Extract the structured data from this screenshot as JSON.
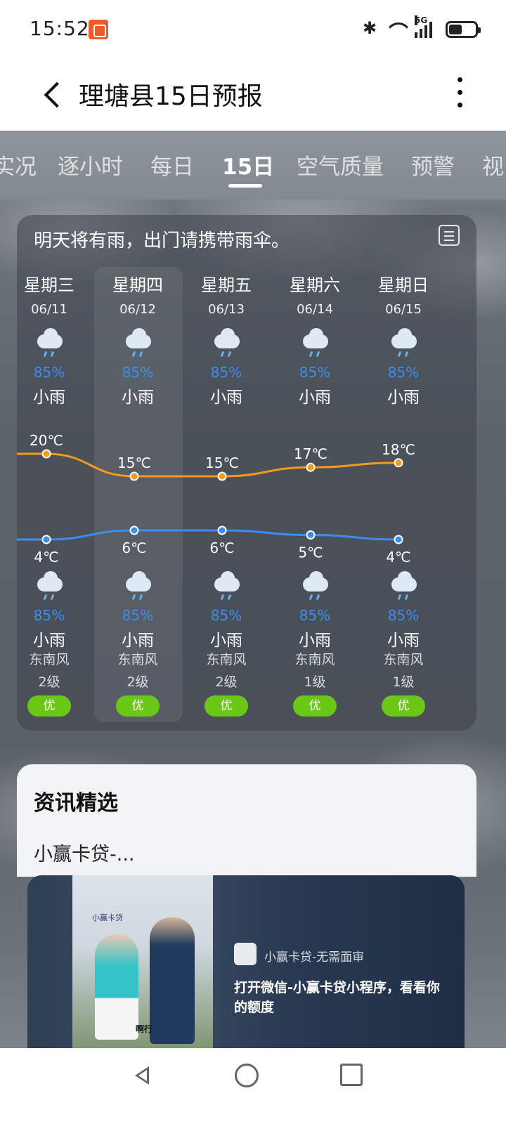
{
  "status_bar": {
    "time": "15:52"
  },
  "header": {
    "title": "理塘县15日预报"
  },
  "tabs": [
    {
      "label": "实况"
    },
    {
      "label": "逐小时"
    },
    {
      "label": "每日"
    },
    {
      "label": "15日"
    },
    {
      "label": "空气质量"
    },
    {
      "label": "预警"
    },
    {
      "label": "视"
    }
  ],
  "forecast": {
    "tip": "明天将有雨，出门请携带雨伞。",
    "days": [
      {
        "name": "星期三",
        "date": "06/11",
        "day_pop": "85%",
        "day_cond": "小雨",
        "high": "20℃",
        "low": "4℃",
        "night_pop": "85%",
        "night_cond": "小雨",
        "wind_dir": "东南风",
        "wind_level": "2级",
        "aqi": "优",
        "high_value": 20,
        "low_value": 4
      },
      {
        "name": "星期四",
        "date": "06/12",
        "day_pop": "85%",
        "day_cond": "小雨",
        "high": "15℃",
        "low": "6℃",
        "night_pop": "85%",
        "night_cond": "小雨",
        "wind_dir": "东南风",
        "wind_level": "2级",
        "aqi": "优",
        "high_value": 15,
        "low_value": 6
      },
      {
        "name": "星期五",
        "date": "06/13",
        "day_pop": "85%",
        "day_cond": "小雨",
        "high": "15℃",
        "low": "6℃",
        "night_pop": "85%",
        "night_cond": "小雨",
        "wind_dir": "东南风",
        "wind_level": "2级",
        "aqi": "优",
        "high_value": 15,
        "low_value": 6
      },
      {
        "name": "星期六",
        "date": "06/14",
        "day_pop": "85%",
        "day_cond": "小雨",
        "high": "17℃",
        "low": "5℃",
        "night_pop": "85%",
        "night_cond": "小雨",
        "wind_dir": "东南风",
        "wind_level": "1级",
        "aqi": "优",
        "high_value": 17,
        "low_value": 5
      },
      {
        "name": "星期日",
        "date": "06/15",
        "day_pop": "85%",
        "day_cond": "小雨",
        "high": "18℃",
        "low": "4℃",
        "night_pop": "85%",
        "night_cond": "小雨",
        "wind_dir": "东南风",
        "wind_level": "1级",
        "aqi": "优",
        "high_value": 18,
        "low_value": 4
      }
    ]
  },
  "news": {
    "title": "资讯精选",
    "item": "小赢卡贷-..."
  },
  "ad": {
    "brand": "小赢卡贷-无需面审",
    "description": "打开微信-小赢卡贷小程序，看看你的额度",
    "photo_watermark": "小赢卡贷",
    "photo_caption": "啊行"
  },
  "colors": {
    "high_line": "#f59a1b",
    "low_line": "#3b8df0",
    "aqi_good": "#6cc817",
    "pop": "#3b8df0"
  }
}
